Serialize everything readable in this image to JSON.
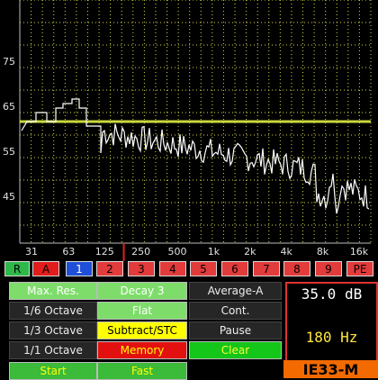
{
  "spectrum": {
    "y_ticks": [
      "75",
      "65",
      "55",
      "45"
    ],
    "x_ticks": [
      "31",
      "63",
      "125",
      "250",
      "500",
      "1k",
      "2k",
      "4k",
      "8k",
      "16k"
    ],
    "reference_level": 63,
    "colors": {
      "grid": "#d8d84a",
      "trace": "#ffffff",
      "reference": "#c8d83c",
      "marker": "#e02020",
      "axis_text": "#e0e0e0"
    }
  },
  "channels": [
    {
      "label": "R",
      "color": "#2fb84a",
      "text": "#000"
    },
    {
      "label": "A",
      "color": "#e21b1b",
      "text": "#000"
    },
    {
      "label": "1",
      "color": "#1f4fd8",
      "text": "#fff"
    },
    {
      "label": "2",
      "color": "#e23b3b",
      "text": "#000"
    },
    {
      "label": "3",
      "color": "#e23b3b",
      "text": "#000"
    },
    {
      "label": "4",
      "color": "#e23b3b",
      "text": "#000"
    },
    {
      "label": "5",
      "color": "#e23b3b",
      "text": "#000"
    },
    {
      "label": "6",
      "color": "#e23b3b",
      "text": "#000"
    },
    {
      "label": "7",
      "color": "#e23b3b",
      "text": "#000"
    },
    {
      "label": "8",
      "color": "#e23b3b",
      "text": "#000"
    },
    {
      "label": "9",
      "color": "#e23b3b",
      "text": "#000"
    },
    {
      "label": "PE",
      "color": "#e23b3b",
      "text": "#000"
    }
  ],
  "buttons": {
    "max_res": "Max. Res.",
    "octave_1_6": "1/6 Octave",
    "octave_1_3": "1/3 Octave",
    "octave_1_1": "1/1 Octave",
    "start": "Start",
    "decay": "Decay 3",
    "flat": "Flat",
    "subtract": "Subtract/STC",
    "memory": "Memory",
    "fast": "Fast",
    "average": "Average-A",
    "cont": "Cont.",
    "pause": "Pause",
    "clear": "Clear"
  },
  "readout": {
    "level": "35.0 dB",
    "frequency": "180 Hz"
  },
  "brand": "IE33-M"
}
